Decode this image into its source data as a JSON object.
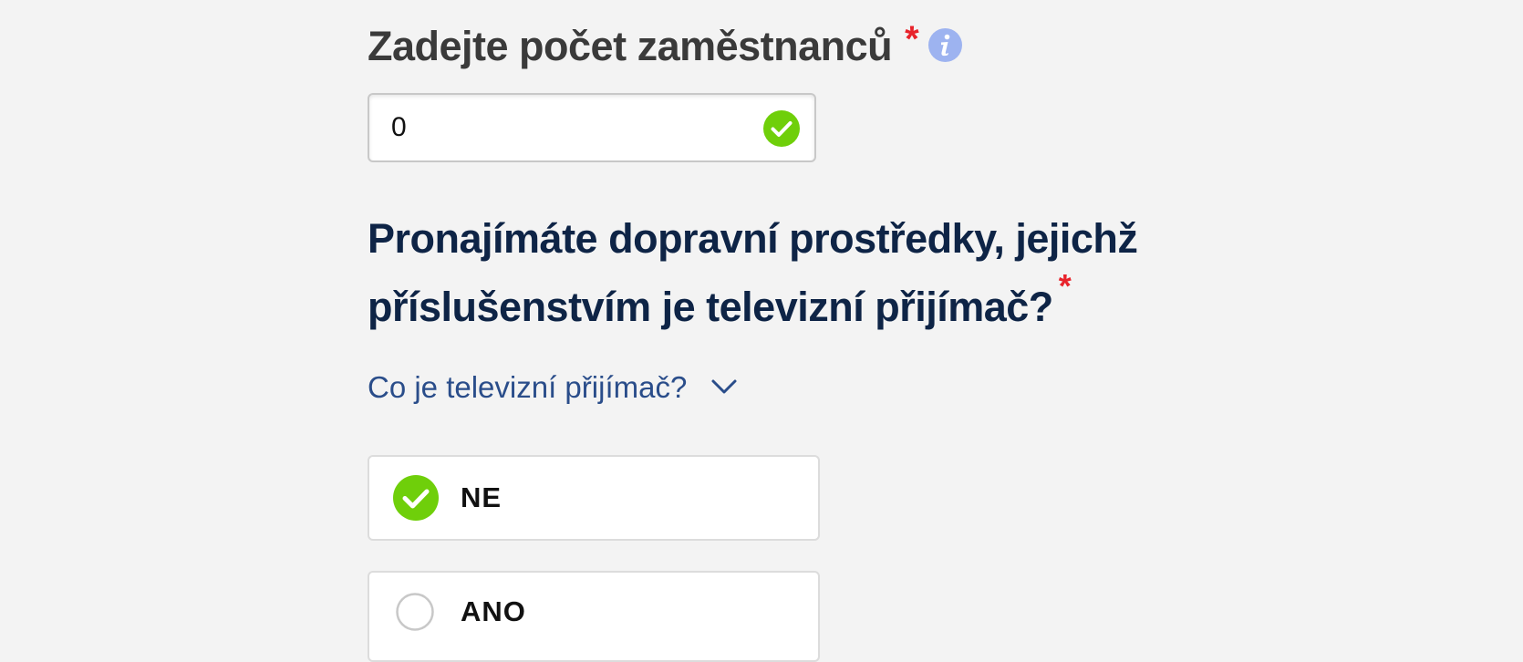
{
  "employees": {
    "label": "Zadejte počet zaměstnanců",
    "required_mark": "*",
    "info_icon": "info-icon",
    "value": "0",
    "status_icon": "check-circle-icon"
  },
  "tv_question": {
    "text": "Pronajímáte dopravní prostředky, jejichž příslušenstvím je televizní přijímač?",
    "required_mark": "*",
    "help_link": "Co je televizní přijímač?",
    "help_icon": "chevron-down-icon",
    "options": [
      {
        "label": "NE",
        "selected": true
      },
      {
        "label": "ANO",
        "selected": false
      }
    ]
  },
  "colors": {
    "background": "#f3f3f3",
    "label": "#3a3a3a",
    "heading": "#0e2446",
    "link": "#2a4d8a",
    "required": "#e8232b",
    "success": "#6fcf0a",
    "info": "#9db3f0"
  }
}
